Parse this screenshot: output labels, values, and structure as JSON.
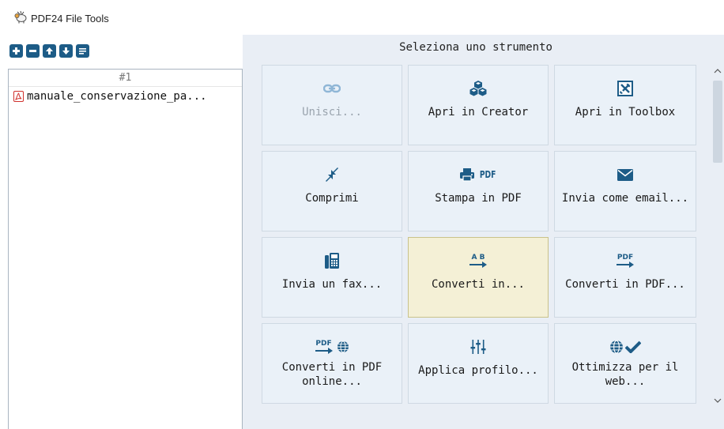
{
  "window": {
    "title": "PDF24 File Tools"
  },
  "toolbar": {
    "buttons": [
      {
        "icon": "plus-icon"
      },
      {
        "icon": "minus-icon"
      },
      {
        "icon": "arrow-up-icon"
      },
      {
        "icon": "arrow-down-icon"
      },
      {
        "icon": "list-icon"
      }
    ]
  },
  "file_list": {
    "column_header": "#1",
    "files": [
      {
        "name": "manuale_conservazione_pa...",
        "icon": "pdf-file-icon"
      }
    ]
  },
  "tools": {
    "title": "Seleziona uno strumento",
    "items": [
      {
        "label": "Unisci...",
        "icon": "link-icon",
        "enabled": false
      },
      {
        "label": "Apri in Creator",
        "icon": "cubes-icon",
        "enabled": true
      },
      {
        "label": "Apri in Toolbox",
        "icon": "tools-icon",
        "enabled": true
      },
      {
        "label": "Comprimi",
        "icon": "compress-icon",
        "enabled": true
      },
      {
        "label": "Stampa in PDF",
        "icon": "printer-pdf-icon",
        "icon_text": "PDF",
        "enabled": true
      },
      {
        "label": "Invia come email...",
        "icon": "envelope-icon",
        "enabled": true
      },
      {
        "label": "Invia un fax...",
        "icon": "fax-icon",
        "enabled": true
      },
      {
        "label": "Converti in...",
        "icon": "convert-ab-icon",
        "icon_text": "A B",
        "enabled": true,
        "hovered": true
      },
      {
        "label": "Converti in PDF...",
        "icon": "convert-pdf-icon",
        "icon_text": "PDF",
        "enabled": true
      },
      {
        "label": "Converti in PDF online...",
        "icon": "convert-pdf-globe-icon",
        "icon_text": "PDF",
        "enabled": true
      },
      {
        "label": "Applica profilo...",
        "icon": "sliders-icon",
        "enabled": true
      },
      {
        "label": "Ottimizza per il web...",
        "icon": "globe-check-icon",
        "enabled": true
      }
    ]
  },
  "colors": {
    "accent": "#1d5c87",
    "tile_bg": "#eaf1f8",
    "tile_hover_bg": "#f4f0d6",
    "panel_bg": "#e9eef5",
    "pdf_red": "#d0312d"
  }
}
